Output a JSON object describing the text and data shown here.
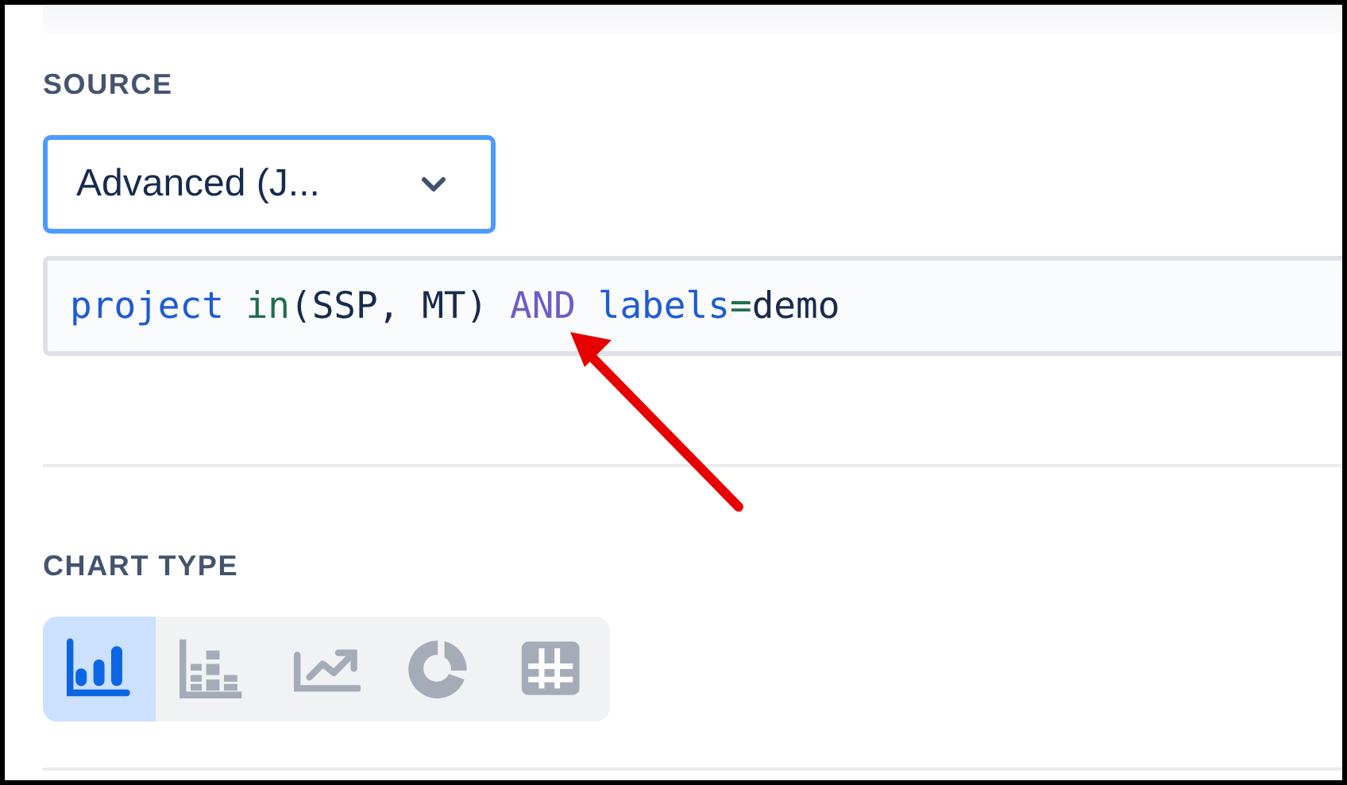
{
  "source": {
    "label": "SOURCE",
    "select": {
      "value": "Advanced (J...",
      "focused": true
    },
    "query": [
      {
        "text": "project ",
        "kind": "field"
      },
      {
        "text": "in",
        "kind": "operator"
      },
      {
        "text": "(SSP, MT) ",
        "kind": "plain"
      },
      {
        "text": "AND ",
        "kind": "keyword"
      },
      {
        "text": "labels",
        "kind": "field"
      },
      {
        "text": "=",
        "kind": "operator"
      },
      {
        "text": "demo",
        "kind": "plain"
      }
    ]
  },
  "annotations": [
    {
      "kind": "arrow"
    }
  ],
  "chart_type": {
    "label": "CHART TYPE",
    "options": [
      {
        "kind": "bar",
        "selected": true
      },
      {
        "kind": "stacked-bar",
        "selected": false
      },
      {
        "kind": "line",
        "selected": false
      },
      {
        "kind": "donut",
        "selected": false
      },
      {
        "kind": "table",
        "selected": false
      }
    ]
  }
}
